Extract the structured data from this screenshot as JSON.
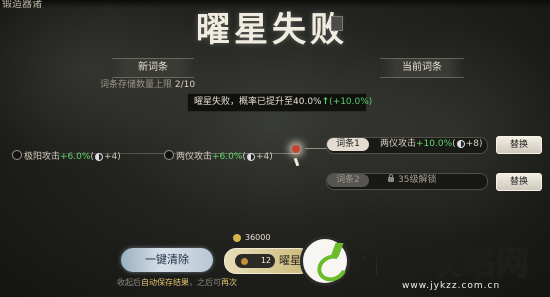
{
  "header": {
    "corner_text": "锻造器诸",
    "title": "曜星失败"
  },
  "sections": {
    "new_entries_label": "新词条",
    "current_entries_label": "当前词条"
  },
  "capacity": {
    "prefix": "词条存储数量上限",
    "value": "2/10"
  },
  "tooltip": {
    "text": "曜星失败，概率已提升至",
    "rate": "40.0%",
    "arrow": "↑",
    "delta": "(+10.0%)"
  },
  "new_entries": [
    {
      "name": "极阳攻击",
      "value": "+6.0%",
      "level": "+4"
    },
    {
      "name": "两仪攻击",
      "value": "+6.0%",
      "level": "+4"
    }
  ],
  "current_entries": [
    {
      "chip": "词条1",
      "name": "两仪攻击",
      "value": "+10.0%",
      "level": "+8",
      "action": "替换",
      "locked": false
    },
    {
      "chip": "词条2",
      "lock_text": "35级解锁",
      "action": "替换",
      "locked": true
    }
  ],
  "buttons": {
    "clear": "一键清除",
    "forge_count": "12",
    "forge_label": "曜星"
  },
  "cost": {
    "amount": "36000"
  },
  "footer": {
    "prefix": "收起后",
    "highlight1": "自动保存结果",
    "middle": "，之后可",
    "highlight2": "再次"
  },
  "watermark": {
    "text": "金烨攻略网",
    "url": "www.jykzz.com.cn"
  },
  "colors": {
    "bonus_green": "#5fd86d",
    "gold": "#d9b24e",
    "alert_node": "#c6452f"
  }
}
